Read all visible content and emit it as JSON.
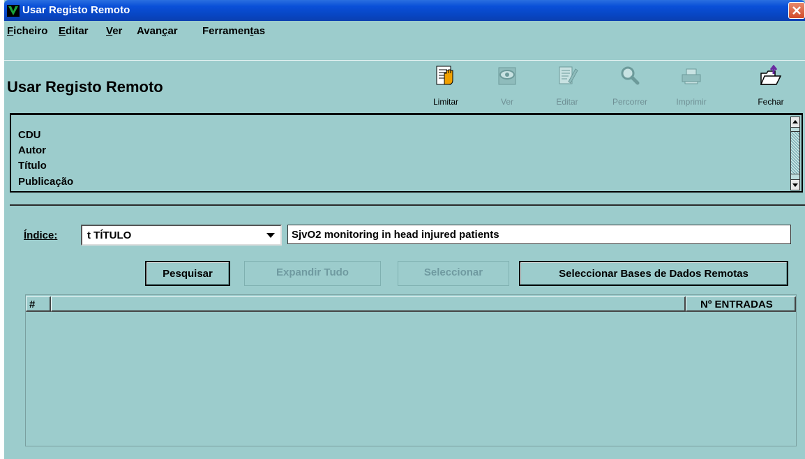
{
  "window": {
    "title": "Usar Registo Remoto"
  },
  "menu": [
    {
      "pre": "",
      "key": "F",
      "post": "icheiro"
    },
    {
      "pre": "",
      "key": "E",
      "post": "ditar"
    },
    {
      "pre": "",
      "key": "V",
      "post": "er"
    },
    {
      "pre": "Avan",
      "key": "ç",
      "post": "ar"
    },
    {
      "pre": "Ferramen",
      "key": "t",
      "post": "as"
    }
  ],
  "header": {
    "title": "Usar Registo Remoto"
  },
  "toolbar": {
    "limitar": "Limitar",
    "ver": "Ver",
    "editar": "Editar",
    "percorrer": "Percorrer",
    "imprimir": "Imprimir",
    "fechar": "Fechar"
  },
  "info": {
    "lines": [
      "CDU",
      "Autor",
      "Título",
      "Publicação"
    ]
  },
  "search": {
    "indice_label": "Índice:",
    "indice_value": "t  TÍTULO",
    "query": "SjvO2 monitoring in head injured patients"
  },
  "buttons": {
    "pesquisar": "Pesquisar",
    "expandir": "Expandir Tudo",
    "seleccionar": "Seleccionar",
    "bases": "Seleccionar Bases de Dados Remotas"
  },
  "table": {
    "col_num": "#",
    "col_entries": "Nº ENTRADAS"
  },
  "icons": {
    "app": "app-v-icon",
    "close": "close-icon",
    "limitar": "hand-stop-icon",
    "ver": "eye-icon",
    "editar": "edit-pencil-icon",
    "percorrer": "magnifier-icon",
    "imprimir": "printer-icon",
    "fechar": "folder-exit-icon"
  }
}
